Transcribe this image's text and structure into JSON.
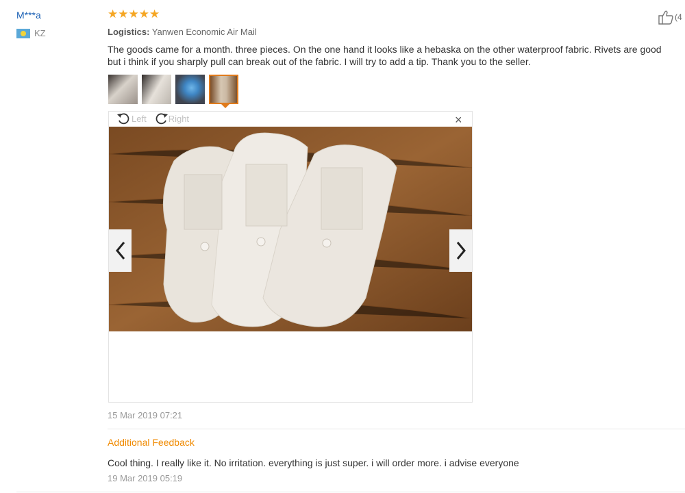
{
  "user": {
    "name": "M***a",
    "country": "KZ"
  },
  "rating": {
    "stars": 5,
    "display": "★★★★★"
  },
  "like": {
    "count_text": "(4"
  },
  "logistics": {
    "label": "Logistics:",
    "value": "Yanwen Economic Air Mail"
  },
  "review": {
    "line1": "The goods came for a month. three pieces. On the one hand it looks like a hebaska on the other waterproof fabric. Rivets are good",
    "line2": "but i think if you sharply pull can break out of the fabric. I will try to add a tip. Thank you to the seller.",
    "date": "15 Mar 2019 07:21"
  },
  "viewer": {
    "rotate_left": "Left",
    "rotate_right": "Right",
    "close": "×"
  },
  "additional": {
    "heading": "Additional Feedback",
    "text": "Cool thing. I really like it. No irritation. everything is just super. i will order more. i advise everyone",
    "date": "19 Mar 2019 05:19"
  },
  "colors": {
    "accent": "#f08a00",
    "user_link": "#1d62b5",
    "star": "#f5a623"
  }
}
